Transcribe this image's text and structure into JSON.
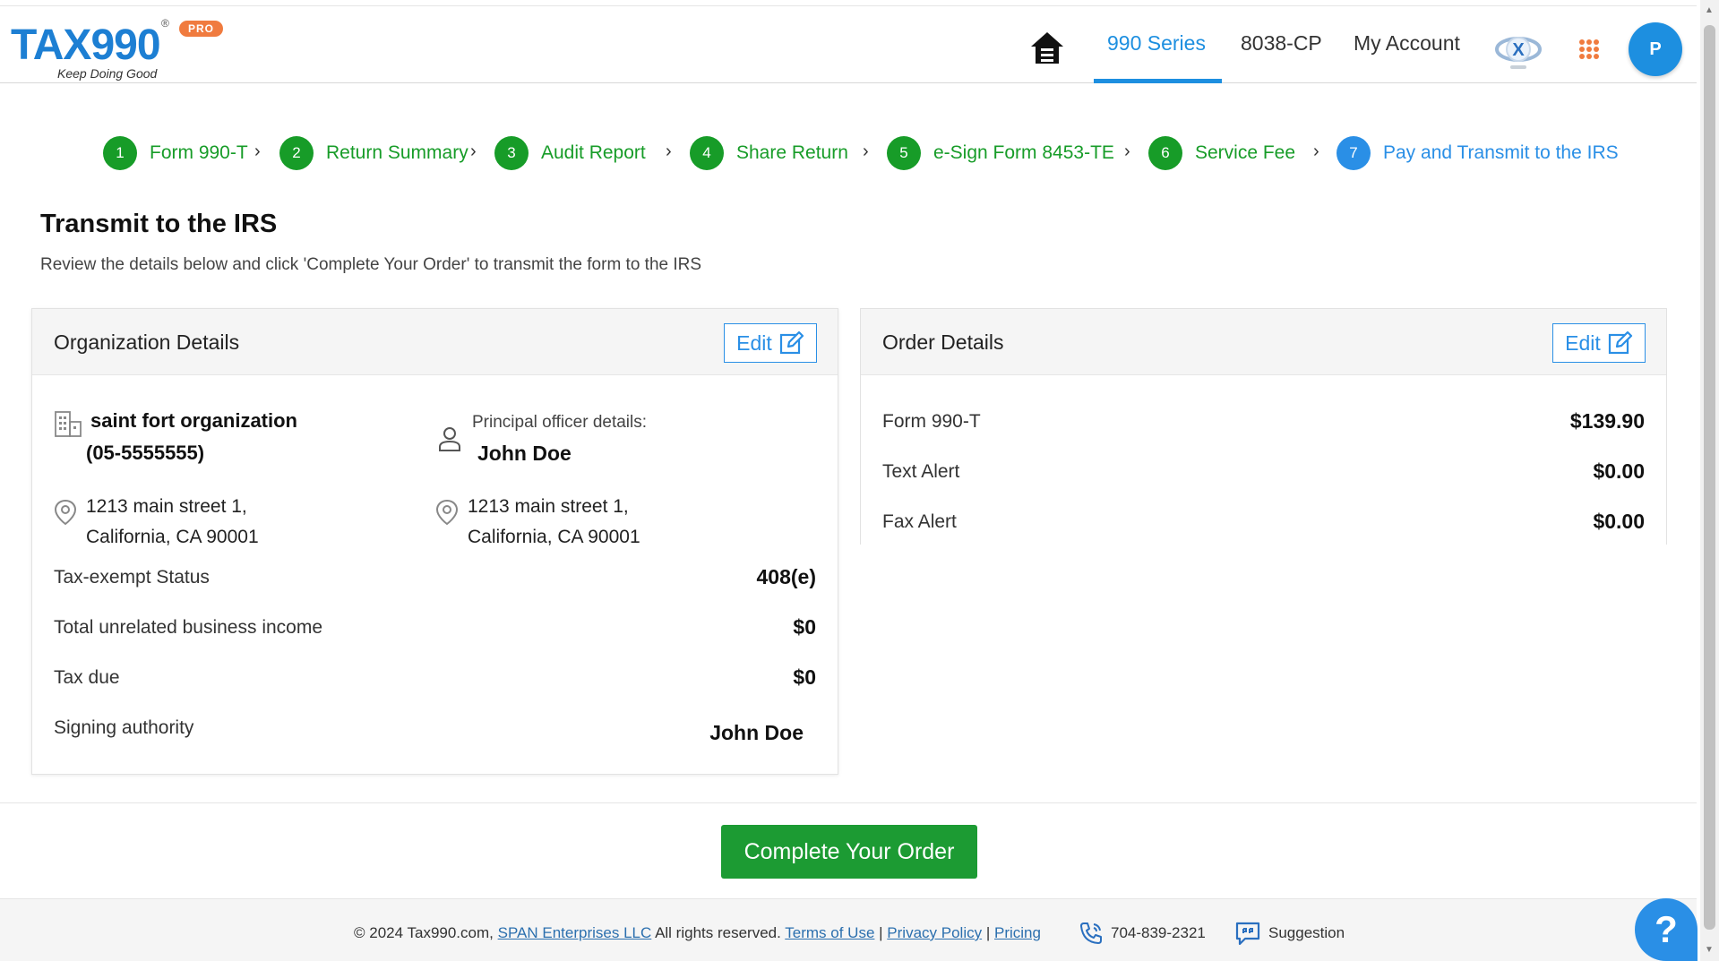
{
  "brand": {
    "logo_text": "TAX990",
    "registered": "®",
    "badge": "PRO",
    "tagline": "Keep Doing Good"
  },
  "nav": {
    "series": "990 Series",
    "cp": "8038-CP",
    "account": "My Account",
    "avatar_initial": "P"
  },
  "steps": [
    {
      "num": "1",
      "label": "Form 990-T"
    },
    {
      "num": "2",
      "label": "Return Summary"
    },
    {
      "num": "3",
      "label": "Audit Report"
    },
    {
      "num": "4",
      "label": "Share Return"
    },
    {
      "num": "5",
      "label": "e-Sign Form 8453-TE"
    },
    {
      "num": "6",
      "label": "Service Fee"
    },
    {
      "num": "7",
      "label": "Pay and Transmit to the IRS"
    }
  ],
  "page": {
    "title": "Transmit to the IRS",
    "subtitle": "Review the details below and click 'Complete Your Order' to transmit the form to the IRS"
  },
  "org_card": {
    "title": "Organization Details",
    "edit_label": "Edit",
    "org_name": "saint fort organization",
    "ein": "(05-5555555)",
    "officer_caption": "Principal officer details:",
    "officer_name": "John Doe",
    "org_address_line1": "1213 main street 1,",
    "org_address_line2": "California, CA 90001",
    "officer_address_line1": "1213 main street 1,",
    "officer_address_line2": "California, CA 90001",
    "rows": [
      {
        "label": "Tax-exempt Status",
        "value": "408(e)"
      },
      {
        "label": "Total unrelated business income",
        "value": "$0"
      },
      {
        "label": "Tax due",
        "value": "$0"
      },
      {
        "label": "Signing authority",
        "value": "John Doe"
      }
    ]
  },
  "order_card": {
    "title": "Order Details",
    "edit_label": "Edit",
    "rows": [
      {
        "label": "Form 990-T",
        "value": "$139.90"
      },
      {
        "label": "Text Alert",
        "value": "$0.00"
      },
      {
        "label": "Fax Alert",
        "value": "$0.00"
      }
    ]
  },
  "actions": {
    "complete_label": "Complete Your Order"
  },
  "footer": {
    "copyright": "© 2024 Tax990.com,",
    "company": "SPAN Enterprises LLC",
    "rights": "All rights reserved.",
    "terms": "Terms of Use",
    "privacy": "Privacy Policy",
    "pricing": "Pricing",
    "sep": "|",
    "phone": "704-839-2321",
    "suggestion": "Suggestion"
  },
  "help": {
    "label": "?"
  },
  "colors": {
    "brand_blue": "#1d7fd3",
    "accent_blue": "#2a8fe6",
    "step_green": "#179c28",
    "button_green": "#1c9b33",
    "pro_orange": "#f07b3f"
  },
  "icons": [
    "home-icon",
    "x-logo-icon",
    "apps-grid-icon",
    "building-icon",
    "person-icon",
    "location-pin-icon",
    "edit-icon",
    "phone-icon",
    "suggestion-icon",
    "help-icon"
  ]
}
